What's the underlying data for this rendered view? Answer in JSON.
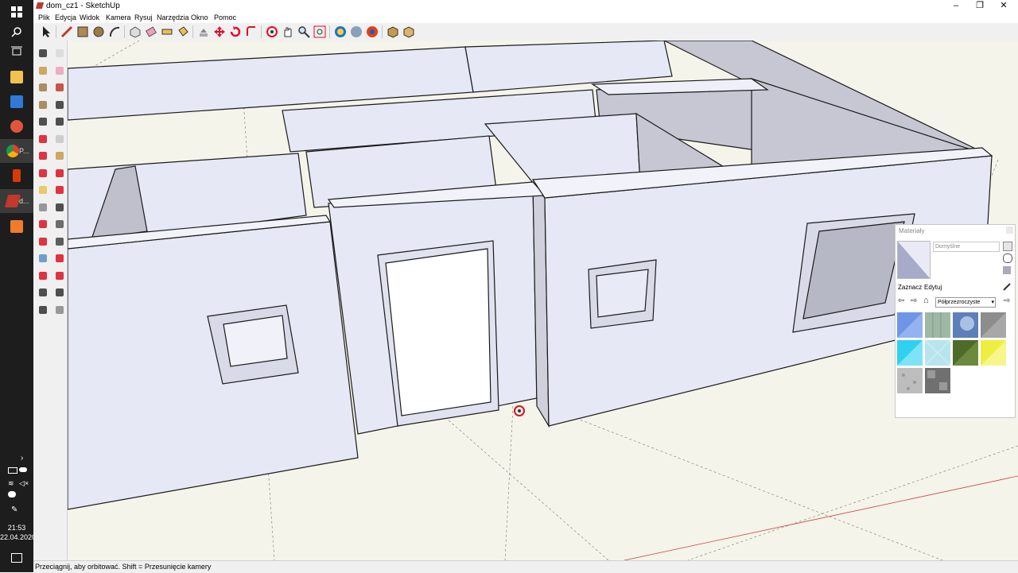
{
  "window": {
    "title": "dom_cz1 - SketchUp",
    "controls": {
      "minimize": "–",
      "restore": "❐",
      "close": "✕"
    }
  },
  "menu": {
    "items": [
      "Plik",
      "Edycja",
      "Widok",
      "Kamera",
      "Rysuj",
      "Narzędzia",
      "Okno",
      "Pomoc"
    ]
  },
  "toolbar": {
    "top_tools": [
      "select-tool",
      "line-tool",
      "rectangle-tool",
      "circle-tool",
      "arc-tool",
      "make-component-tool",
      "eraser-tool",
      "tape-measure-tool",
      "paint-bucket-tool",
      "push-pull-tool",
      "move-tool",
      "rotate-tool",
      "offset-tool",
      "orbit-tool",
      "pan-tool",
      "zoom-tool",
      "zoom-extents-tool",
      "get-models-tool",
      "extension-warehouse-tool",
      "sketchup-3d-warehouse-tool",
      "components-tool",
      "sandbox-tool"
    ],
    "left_tools": [
      "select-tool",
      "eraser-tool",
      "paint-bucket-tool",
      "eraser-alt-tool",
      "rectangle-tool",
      "line-tool",
      "circle-tool",
      "arc-tool",
      "polygon-tool",
      "freehand-tool",
      "move-tool",
      "push-pull-tool",
      "rotate-tool",
      "follow-me-tool",
      "scale-tool",
      "offset-tool",
      "tape-measure-tool",
      "dimension-tool",
      "protractor-tool",
      "text-tool",
      "axes-tool",
      "3d-text-tool",
      "orbit-tool",
      "pan-tool",
      "zoom-tool",
      "zoom-window-tool",
      "previous-view-tool",
      "zoom-extents-tool",
      "walk-tool",
      "look-around-tool",
      "position-camera-tool",
      "section-plane-tool"
    ]
  },
  "taskbar": {
    "items": [
      {
        "icon": "windows-start-icon",
        "label": ""
      },
      {
        "icon": "search-icon",
        "label": ""
      },
      {
        "icon": "task-view-icon",
        "label": ""
      },
      {
        "icon": "file-explorer-icon",
        "label": ""
      },
      {
        "icon": "save-disk-icon",
        "label": ""
      },
      {
        "icon": "settings-gear-icon",
        "label": ""
      },
      {
        "icon": "chrome-icon",
        "label": "P..."
      },
      {
        "icon": "office-icon",
        "label": ""
      },
      {
        "icon": "sketchup-icon",
        "label": "d..."
      },
      {
        "icon": "recorder-icon",
        "label": ""
      }
    ],
    "clock_time": "21:53",
    "clock_date": "22.04.2020"
  },
  "status": {
    "text": "Przeciągnij, aby orbitować. Shift = Przesunięcie kamery"
  },
  "materials": {
    "title": "Materiały",
    "name_value": "Domyślne",
    "tabs": [
      "Zaznacz",
      "Edytuj"
    ],
    "collection": "Półprzezroczyste",
    "swatches": [
      {
        "name": "translucent-blue",
        "color": "#6f96e6"
      },
      {
        "name": "translucent-green-glass",
        "color": "#9fb8a6"
      },
      {
        "name": "translucent-sky",
        "color": "#5f7fb8"
      },
      {
        "name": "translucent-gray",
        "color": "#8d8d8d"
      },
      {
        "name": "translucent-cyan",
        "color": "#30d0f0"
      },
      {
        "name": "translucent-light-blue",
        "color": "#b8e4ee"
      },
      {
        "name": "translucent-olive",
        "color": "#4f6b2a"
      },
      {
        "name": "translucent-yellow",
        "color": "#eeee40"
      },
      {
        "name": "translucent-noise",
        "color": "#bdbdbd"
      },
      {
        "name": "translucent-pattern",
        "color": "#707070"
      }
    ]
  },
  "colors": {
    "wall": "#e6e8f5",
    "wall_shade": "#bfc0cc",
    "ground": "#f4f4ea",
    "edge": "#1a1a1a"
  }
}
